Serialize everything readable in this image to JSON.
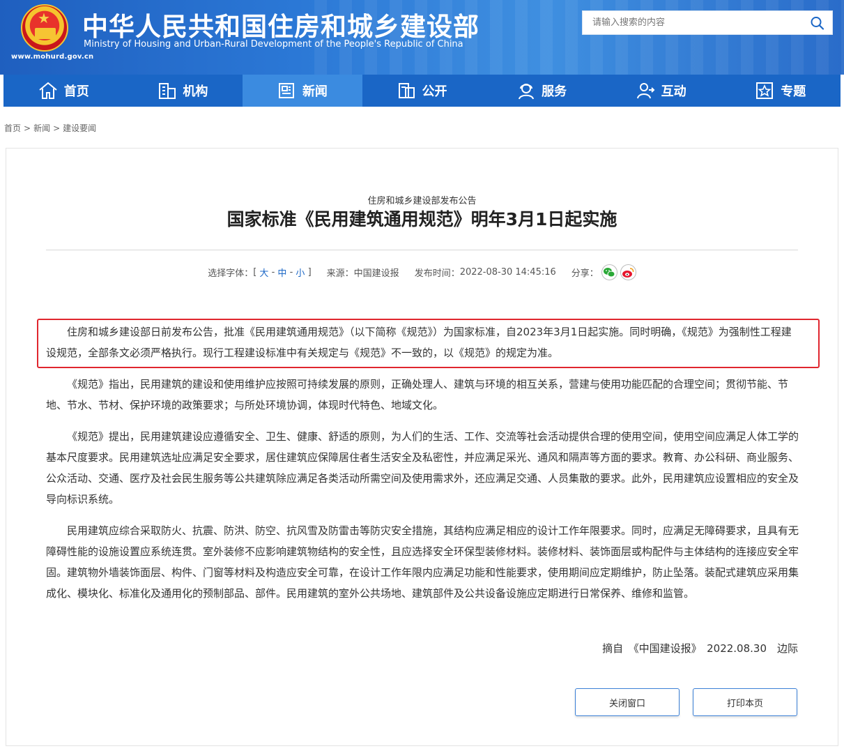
{
  "header": {
    "title": "中华人民共和国住房和城乡建设部",
    "subtitle": "Ministry of Housing and Urban-Rural Development of the People's Republic of China",
    "url": "www.mohurd.gov.cn",
    "search_placeholder": "请输入搜索的内容"
  },
  "nav": {
    "items": [
      {
        "label": "首页",
        "icon": "home-icon"
      },
      {
        "label": "机构",
        "icon": "building-icon"
      },
      {
        "label": "新闻",
        "icon": "news-icon",
        "active": true
      },
      {
        "label": "公开",
        "icon": "document-icon"
      },
      {
        "label": "服务",
        "icon": "service-icon"
      },
      {
        "label": "互动",
        "icon": "interact-icon"
      },
      {
        "label": "专题",
        "icon": "star-icon"
      }
    ]
  },
  "breadcrumb": [
    "首页",
    "新闻",
    "建设要闻"
  ],
  "breadcrumb_sep": ">",
  "article": {
    "pre_title": "住房和城乡建设部发布公告",
    "title": "国家标准《民用建筑通用规范》明年3月1日起实施",
    "meta": {
      "font_label": "选择字体：",
      "font_open": "[",
      "font_large": "大",
      "font_medium": "中",
      "font_small": "小",
      "font_dash": "-",
      "font_close": "]",
      "source_label": "来源：",
      "source": "中国建设报",
      "time_label": "发布时间：",
      "time": "2022-08-30 14:45:16",
      "share_label": "分享："
    },
    "paragraphs": [
      "住房和城乡建设部日前发布公告，批准《民用建筑通用规范》（以下简称《规范》）为国家标准，自2023年3月1日起实施。同时明确，《规范》为强制性工程建设规范，全部条文必须严格执行。现行工程建设标准中有关规定与《规范》不一致的，以《规范》的规定为准。",
      "《规范》指出，民用建筑的建设和使用维护应按照可持续发展的原则，正确处理人、建筑与环境的相互关系，营建与使用功能匹配的合理空间；贯彻节能、节地、节水、节材、保护环境的政策要求；与所处环境协调，体现时代特色、地域文化。",
      "《规范》提出，民用建筑建设应遵循安全、卫生、健康、舒适的原则，为人们的生活、工作、交流等社会活动提供合理的使用空间，使用空间应满足人体工学的基本尺度要求。民用建筑选址应满足安全要求，居住建筑应保障居住者生活安全及私密性，并应满足采光、通风和隔声等方面的要求。教育、办公科研、商业服务、公众活动、交通、医疗及社会民生服务等公共建筑除应满足各类活动所需空间及使用需求外，还应满足交通、人员集散的要求。此外，民用建筑应设置相应的安全及导向标识系统。",
      "民用建筑应综合采取防火、抗震、防洪、防空、抗风雪及防雷击等防灾安全措施，其结构应满足相应的设计工作年限要求。同时，应满足无障碍要求，且具有无障碍性能的设施设置应系统连贯。室外装修不应影响建筑物结构的安全性，且应选择安全环保型装修材料。装修材料、装饰面层或构配件与主体结构的连接应安全牢固。建筑物外墙装饰面层、构件、门窗等材料及构造应安全可靠，在设计工作年限内应满足功能和性能要求，使用期间应定期维护，防止坠落。装配式建筑应采用集成化、模块化、标准化及通用化的预制部品、部件。民用建筑的室外公共场地、建筑部件及公共设备设施应定期进行日常保养、维修和监管。"
    ],
    "signature": "摘自　《中国建设报》　2022.08.30　边际",
    "highlight_color": "#e0262e"
  },
  "buttons": {
    "close": "关闭窗口",
    "print": "打印本页"
  },
  "colors": {
    "nav": "#1a66c6",
    "nav_active": "#3b8be0",
    "link": "#1a66c6"
  }
}
